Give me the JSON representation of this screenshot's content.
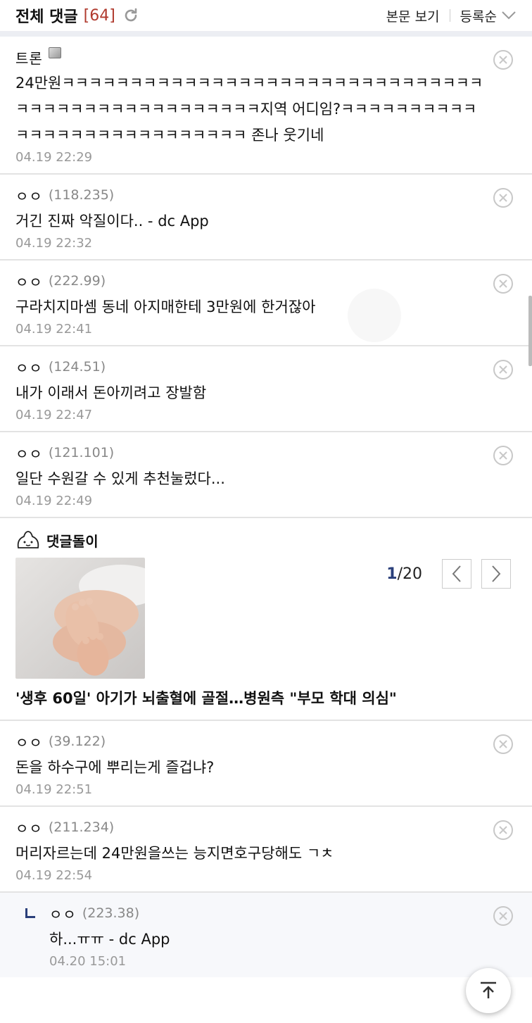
{
  "header": {
    "title": "전체 댓글",
    "count": "[64]",
    "view_body": "본문 보기",
    "sort": "등록순"
  },
  "comments": [
    {
      "author": "트론",
      "ip": "",
      "has_badge": true,
      "text": "24만원ㅋㅋㅋㅋㅋㅋㅋㅋㅋㅋㅋㅋㅋㅋㅋㅋㅋㅋㅋㅋㅋㅋㅋㅋㅋㅋㅋㅋㅋㅋㅋㅋㅋㅋㅋㅋㅋㅋㅋㅋㅋㅋㅋㅋㅋㅋㅋㅋㅋ지역 어디임?ㅋㅋㅋㅋㅋㅋㅋㅋㅋㅋㅋㅋㅋㅋㅋㅋㅋㅋㅋㅋㅋㅋㅋㅋㅋㅋㅋ 존나 웃기네",
      "date": "04.19 22:29"
    },
    {
      "author": "ㅇㅇ",
      "ip": "(118.235)",
      "text": "거긴 진짜 악질이다.. - dc App",
      "date": "04.19 22:32"
    },
    {
      "author": "ㅇㅇ",
      "ip": "(222.99)",
      "text": "구라치지마셈 동네 아지매한테 3만원에 한거잖아",
      "date": "04.19 22:41"
    },
    {
      "author": "ㅇㅇ",
      "ip": "(124.51)",
      "text": "내가 이래서 돈아끼려고 장발함",
      "date": "04.19 22:47"
    },
    {
      "author": "ㅇㅇ",
      "ip": "(121.101)",
      "text": "일단 수원갈 수 있게 추천눌렀다...",
      "date": "04.19 22:49"
    }
  ],
  "bot": {
    "name": "댓글돌이",
    "page_current": "1",
    "page_total": "/20",
    "headline": "'생후 60일' 아기가 뇌출혈에 골절…병원측 \"부모 학대 의심\""
  },
  "comments2": [
    {
      "author": "ㅇㅇ",
      "ip": "(39.122)",
      "text": "돈을 하수구에 뿌리는게 즐겁냐?",
      "date": "04.19 22:51"
    },
    {
      "author": "ㅇㅇ",
      "ip": "(211.234)",
      "text": "머리자르는데 24만원을쓰는 능지면호구당해도 ㄱㅊ",
      "date": "04.19 22:54"
    }
  ],
  "reply": {
    "author": "ㅇㅇ",
    "ip": "(223.38)",
    "text": "하...ㅠㅠ - dc App",
    "date": "04.20 15:01"
  },
  "colors": {
    "accent": "#2a3f7a",
    "count_red": "#b03a2e",
    "divider": "#eceef3"
  }
}
